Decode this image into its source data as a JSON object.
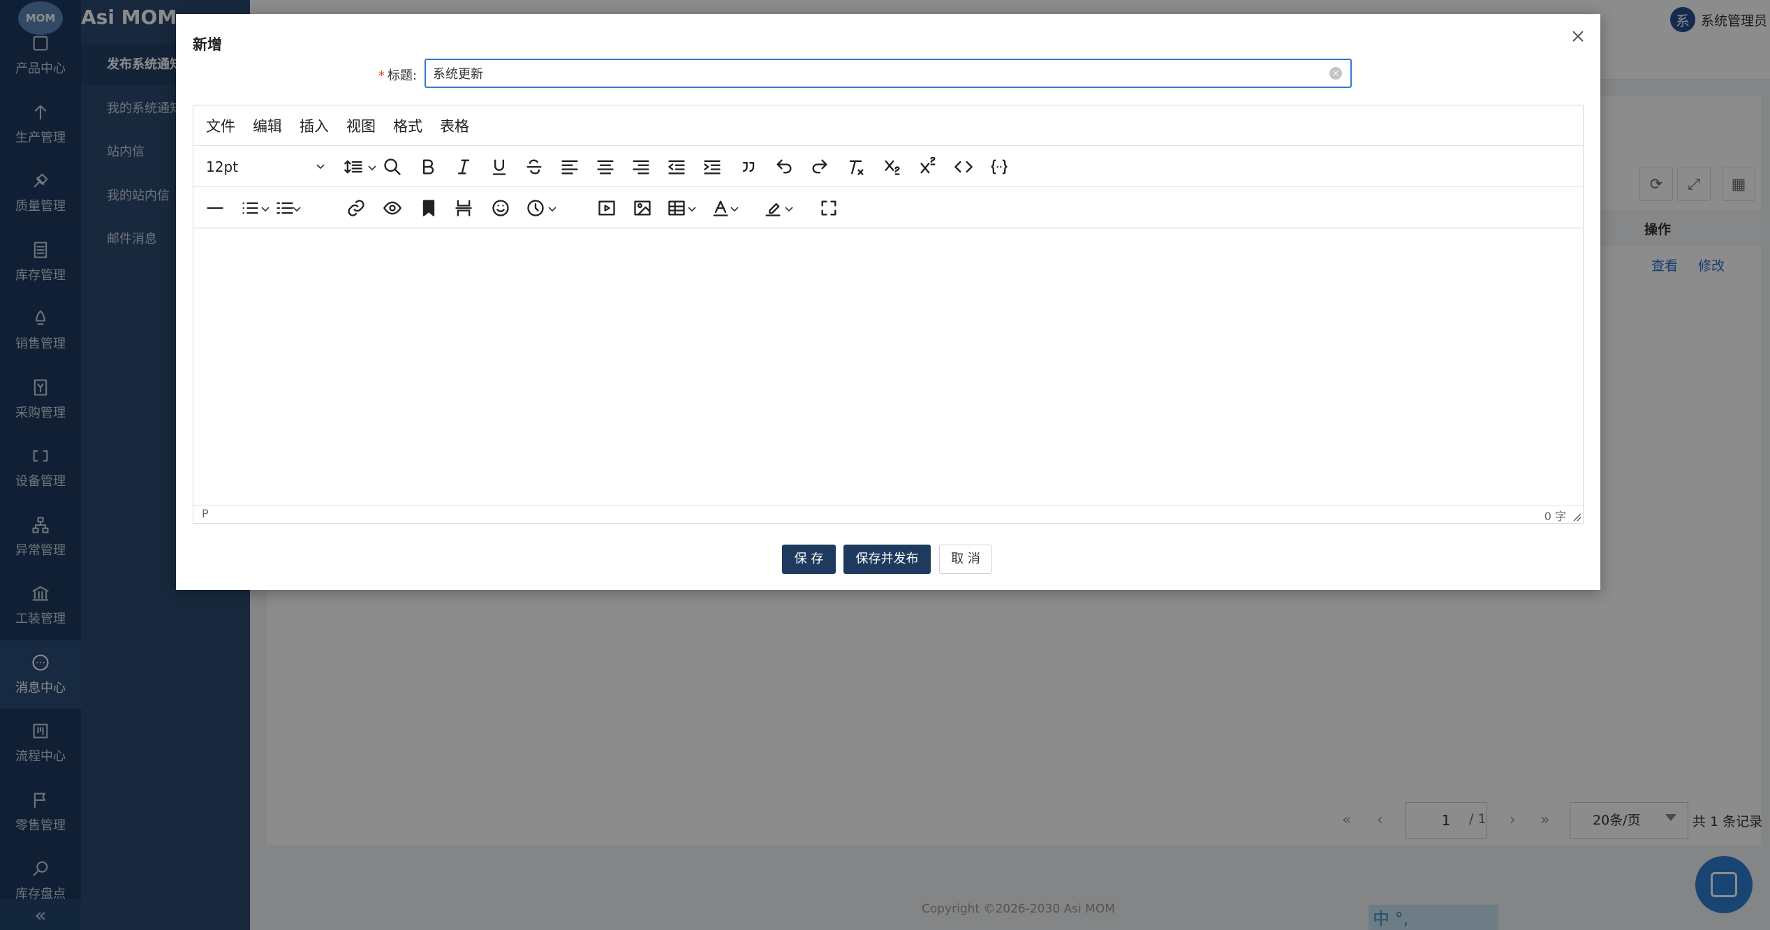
{
  "app": {
    "name": "Asi MOM",
    "logo_text": "MOM",
    "collapse_glyph": "«"
  },
  "rail": {
    "items": [
      {
        "label": "产品中心",
        "icon": "product-icon"
      },
      {
        "label": "生产管理",
        "icon": "production-icon"
      },
      {
        "label": "质量管理",
        "icon": "quality-icon"
      },
      {
        "label": "库存管理",
        "icon": "inventory-icon"
      },
      {
        "label": "销售管理",
        "icon": "sales-icon"
      },
      {
        "label": "采购管理",
        "icon": "purchase-icon"
      },
      {
        "label": "设备管理",
        "icon": "equipment-icon"
      },
      {
        "label": "异常管理",
        "icon": "exception-icon"
      },
      {
        "label": "工装管理",
        "icon": "tooling-icon"
      },
      {
        "label": "消息中心",
        "icon": "message-icon"
      },
      {
        "label": "流程中心",
        "icon": "workflow-icon"
      },
      {
        "label": "零售管理",
        "icon": "retail-icon"
      },
      {
        "label": "库存盘点",
        "icon": "stocktake-icon"
      }
    ],
    "active_label": "消息中心"
  },
  "subnav": {
    "items": [
      "发布系统通知",
      "我的系统通知",
      "站内信",
      "我的站内信",
      "邮件消息"
    ]
  },
  "header": {
    "user_avatar": "系",
    "user_name": "系统管理员"
  },
  "table": {
    "op_column": "操作",
    "row_actions": {
      "view": "查看",
      "edit": "修改"
    }
  },
  "pagination": {
    "first": "«",
    "prev": "‹",
    "next": "›",
    "last": "»",
    "current_page": "1",
    "total_pages": "/ 1",
    "page_size": "20条/页",
    "total_records": "共 1 条记录"
  },
  "footer": {
    "copyright": "Copyright ©2026-2030 Asi MOM",
    "ime_hint": "中 °,"
  },
  "modal": {
    "title": "新增",
    "form": {
      "title_label": "标题:",
      "required_mark": "*",
      "title_value": "系统更新",
      "clear_glyph": "×"
    },
    "editor": {
      "menus": [
        "文件",
        "编辑",
        "插入",
        "视图",
        "格式",
        "表格"
      ],
      "font_size": "12pt",
      "toolbar_row1_icons": [
        "line-height-icon",
        "search-replace-icon",
        "bold-icon",
        "italic-icon",
        "underline-icon",
        "strikethrough-icon",
        "align-left-icon",
        "align-center-icon",
        "align-right-icon",
        "outdent-icon",
        "indent-icon",
        "blockquote-icon",
        "undo-icon",
        "redo-icon",
        "remove-format-icon",
        "subscript-icon",
        "superscript-icon",
        "code-icon",
        "template-icon"
      ],
      "toolbar_row2_icons": [
        "horizontal-rule-icon",
        "bullet-list-icon",
        "numbered-list-icon",
        "link-icon",
        "preview-icon",
        "bookmark-icon",
        "page-break-icon",
        "emoji-icon",
        "datetime-icon",
        "media-icon",
        "image-icon",
        "table-icon",
        "text-color-icon",
        "highlight-color-icon",
        "fullscreen-icon"
      ],
      "status_path": "P",
      "word_count": "0 字"
    },
    "buttons": {
      "save": "保 存",
      "save_publish": "保存并发布",
      "cancel": "取 消"
    }
  },
  "colors": {
    "primary": "#1e3a5f",
    "focus_border": "#3a77d0",
    "link": "#2d6fd6",
    "required": "#e5453d"
  }
}
